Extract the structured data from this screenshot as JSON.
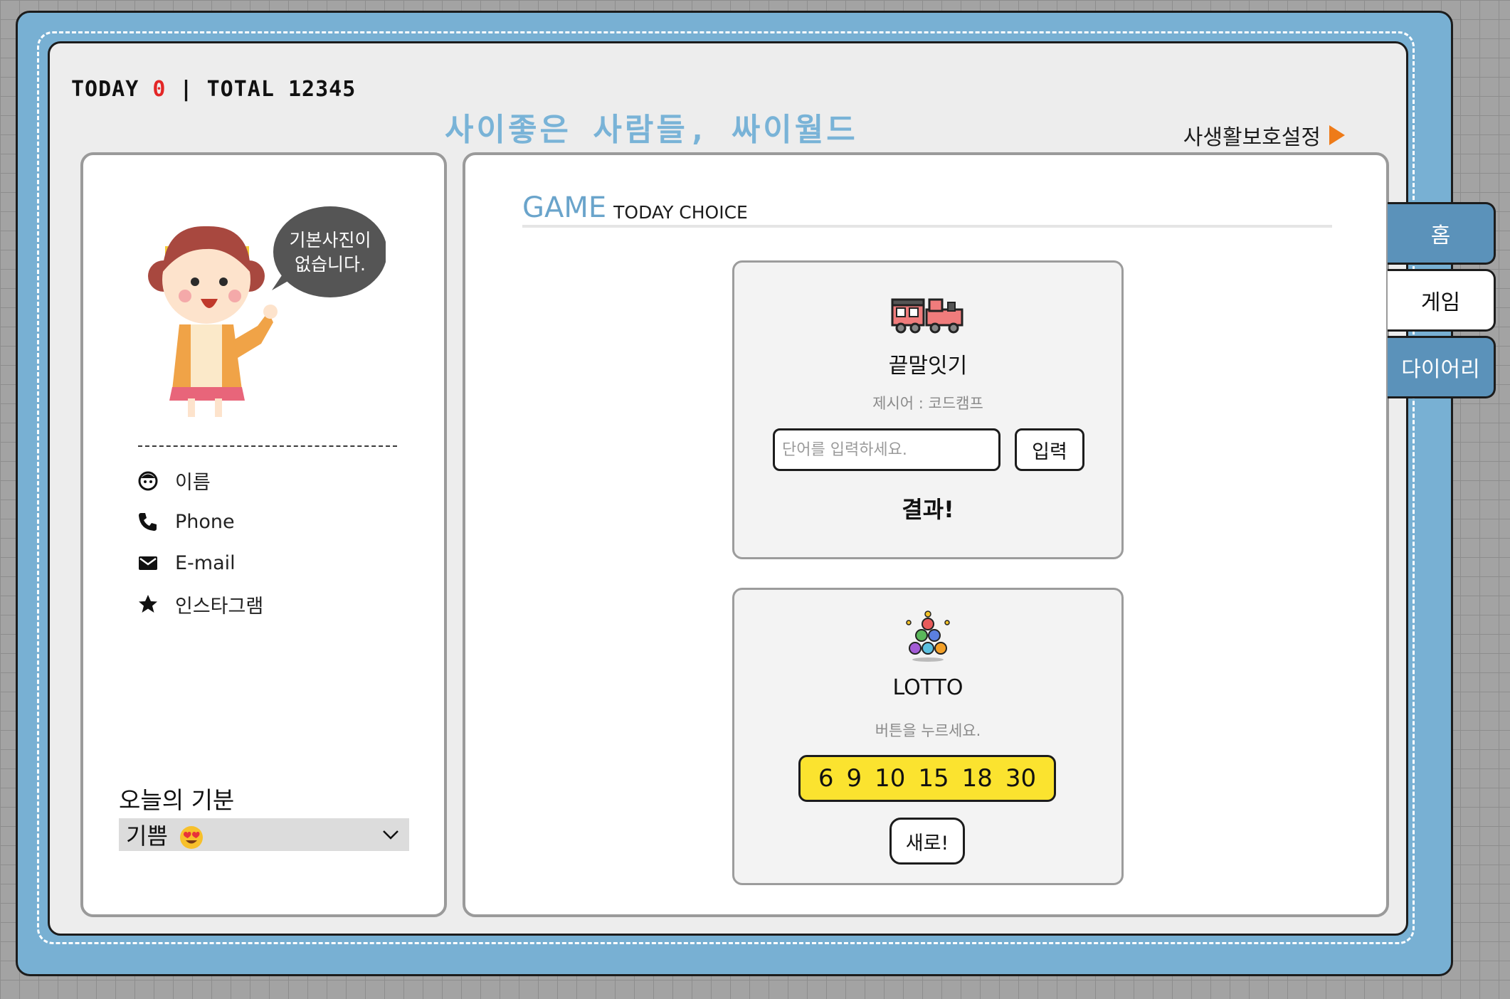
{
  "header": {
    "today_label": "TODAY",
    "today_count": "0",
    "separator": "|",
    "total_label": "TOTAL",
    "total_count": "12345",
    "site_title": "사이좋은 사람들, 싸이월드",
    "privacy_link": "사생활보호설정"
  },
  "profile": {
    "speech_bubble_line1": "기본사진이",
    "speech_bubble_line2": "없습니다.",
    "info_items": [
      {
        "label": "이름",
        "icon": "face-icon"
      },
      {
        "label": "Phone",
        "icon": "phone-icon"
      },
      {
        "label": "E-mail",
        "icon": "mail-icon"
      },
      {
        "label": "인스타그램",
        "icon": "star-icon"
      }
    ],
    "mood_label": "오늘의 기분",
    "mood_selected": "기쁨",
    "mood_icon": "heart-eyes-emoji"
  },
  "game": {
    "heading_main": "GAME",
    "heading_sub": "TODAY CHOICE",
    "word_chain": {
      "icon": "train-icon",
      "title": "끝말잇기",
      "subtitle": "제시어 : 코드캠프",
      "input_placeholder": "단어를 입력하세요.",
      "input_value": "",
      "enter_button": "입력",
      "result": "결과!"
    },
    "lotto": {
      "icon": "lotto-balls-icon",
      "title": "LOTTO",
      "subtitle": "버튼을 누르세요.",
      "numbers": [
        "6",
        "9",
        "10",
        "15",
        "18",
        "30"
      ],
      "new_button": "새로!"
    }
  },
  "nav_tabs": [
    {
      "label": "홈",
      "active": true
    },
    {
      "label": "게임",
      "active": false
    },
    {
      "label": "다이어리",
      "active": true
    }
  ],
  "colors": {
    "frame_blue": "#78b0d3",
    "title_blue": "#79b3d7",
    "tab_blue": "#5b92ba",
    "lotto_yellow": "#fbe32f",
    "today_red": "#e32626",
    "privacy_orange": "#ee7b19"
  }
}
